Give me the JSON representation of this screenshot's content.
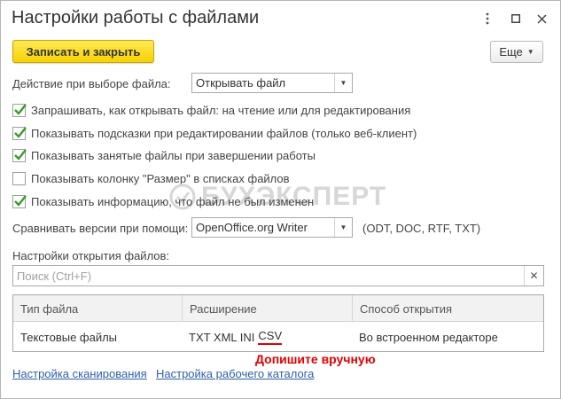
{
  "window": {
    "title": "Настройки работы с файлами",
    "more_icon": "vertical-dots-icon",
    "maximize_icon": "square-icon",
    "close_icon": "close-icon"
  },
  "toolbar": {
    "save_close_label": "Записать и закрыть",
    "more_label": "Еще"
  },
  "file_action": {
    "label": "Действие при выборе файла:",
    "value": "Открывать файл"
  },
  "checkboxes": [
    {
      "label": "Запрашивать, как открывать файл: на чтение или для редактирования",
      "checked": true
    },
    {
      "label": "Показывать подсказки при редактировании файлов (только веб-клиент)",
      "checked": true
    },
    {
      "label": "Показывать занятые файлы при завершении работы",
      "checked": true
    },
    {
      "label": "Показывать колонку \"Размер\" в списках файлов",
      "checked": false
    },
    {
      "label": "Показывать информацию, что файл не был изменен",
      "checked": true
    }
  ],
  "compare": {
    "label": "Сравнивать версии при помощи:",
    "value": "OpenOffice.org Writer",
    "formats": "(ODT, DOC, RTF, TXT)"
  },
  "open_settings": {
    "label": "Настройки открытия файлов:",
    "search_placeholder": "Поиск (Ctrl+F)"
  },
  "table": {
    "columns": [
      "Тип файла",
      "Расширение",
      "Способ открытия"
    ],
    "rows": [
      {
        "type": "Текстовые файлы",
        "ext_main": "TXT XML INI",
        "ext_added": "CSV",
        "method": "Во встроенном редакторе"
      }
    ]
  },
  "annotation": "Допишите вручную",
  "links": {
    "scan": "Настройка сканирования",
    "workdir": "Настройка рабочего каталога"
  },
  "watermark": "БУХЭКСПЕРТ",
  "colors": {
    "accent_yellow": "#f6d200",
    "check_green": "#3a9a2c",
    "link_blue": "#2e5fa8",
    "annotation_red": "#e00000"
  }
}
